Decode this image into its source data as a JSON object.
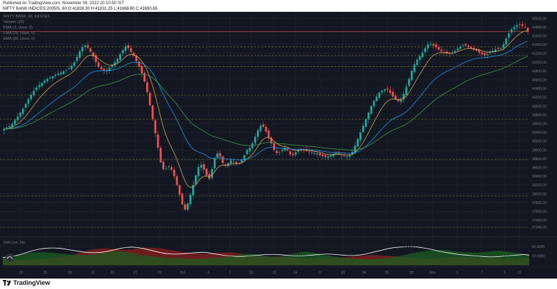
{
  "header": {
    "published": "Published on TradingView.com, November 09, 2022 20:10:50 IST",
    "symbol": "NIFTY BANK INDICES:2005IS, 60",
    "ohlc": "O:41828.30 H:41831.25 L:41668.80 C:41690.65"
  },
  "footer": {
    "brand": "TradingView"
  },
  "legend": {
    "title": "NIFTY BANK, 60, INDICES",
    "volume": "Volume (20)",
    "ema9": "EMA (9, close, 0)",
    "ema26": "EMA (26, close, 0)",
    "ema50": "EMA (50, close, 0)",
    "dmi": "DMI (14, 14)"
  },
  "colors": {
    "background": "#131722",
    "up": "#26a69a",
    "down": "#ef5350",
    "ema9": "#d4a955",
    "ema26": "#2196f3",
    "ema50": "#43a047",
    "hline": "#6b6a2f",
    "price_line": "#ef5350",
    "dmi_line": "#ffffff"
  },
  "chart_data": [
    {
      "type": "candlestick",
      "title": "NIFTY BANK, 60, INDICES",
      "last_price_label": "41690.65",
      "y_ticks": [
        "42000.00",
        "41800.00",
        "41600.00",
        "41400.00",
        "41200.00",
        "41000.00",
        "40800.00",
        "40600.00",
        "40400.00",
        "40200.00",
        "40000.00",
        "39800.00",
        "39600.00",
        "39400.00",
        "39200.00",
        "39000.00",
        "38800.00",
        "38600.00",
        "38400.00",
        "38200.00",
        "38000.00",
        "37800.00",
        "37600.00",
        "37400.00",
        "37240.00"
      ],
      "ylim": [
        37100,
        42100
      ],
      "x_ticks": [
        {
          "label": "13",
          "i": 0.11
        },
        {
          "label": "15",
          "i": 0.26
        },
        {
          "label": "19",
          "i": 0.41
        },
        {
          "label": "21",
          "i": 0.55
        },
        {
          "label": "23",
          "i": 0.67
        },
        {
          "label": "27",
          "i": 0.81
        },
        {
          "label": "29",
          "i": 0.96
        },
        {
          "label": "Oct",
          "i": 1.1
        },
        {
          "label": "6",
          "i": 1.26
        },
        {
          "label": "7",
          "i": 1.39
        },
        {
          "label": "10",
          "i": 1.52
        },
        {
          "label": "12",
          "i": 1.66
        },
        {
          "label": "14",
          "i": 1.79
        },
        {
          "label": "17",
          "i": 1.94
        },
        {
          "label": "20",
          "i": 2.08
        },
        {
          "label": "24",
          "i": 2.21
        },
        {
          "label": "26",
          "i": 2.35
        },
        {
          "label": "28",
          "i": 2.5
        },
        {
          "label": "Nov",
          "i": 2.63
        },
        {
          "label": "3",
          "i": 2.78
        },
        {
          "label": "7",
          "i": 2.93
        },
        {
          "label": "9",
          "i": 3.07
        },
        {
          "label": "12",
          "i": 3.16
        }
      ],
      "horizontal_levels": [
        41350,
        41150,
        40900,
        40250,
        39700,
        38780,
        37950,
        37240
      ],
      "series": [
        {
          "name": "EMA (9, close, 0)",
          "key": "ema9"
        },
        {
          "name": "EMA (26, close, 0)",
          "key": "ema26"
        },
        {
          "name": "EMA (50, close, 0)",
          "key": "ema50"
        }
      ],
      "closes": [
        39480,
        39510,
        39540,
        39600,
        39680,
        39760,
        39850,
        39940,
        40050,
        40160,
        40260,
        40350,
        40420,
        40480,
        40530,
        40580,
        40620,
        40650,
        40680,
        40710,
        40740,
        40760,
        40790,
        40820,
        40860,
        40920,
        41000,
        41120,
        41250,
        41340,
        41380,
        41330,
        41240,
        41130,
        41000,
        40900,
        40840,
        40800,
        40820,
        40870,
        40930,
        41000,
        41080,
        41180,
        41280,
        41360,
        41320,
        41230,
        41140,
        41020,
        40900,
        40750,
        40560,
        40320,
        40020,
        39700,
        39380,
        39050,
        38720,
        38560,
        38580,
        38620,
        38550,
        38400,
        38200,
        37980,
        37760,
        37640,
        37780,
        37980,
        38200,
        38420,
        38610,
        38660,
        38550,
        38420,
        38340,
        38560,
        38810,
        38920,
        38850,
        38700,
        38640,
        38700,
        38760,
        38730,
        38680,
        38700,
        38780,
        38880,
        39000,
        39050,
        39150,
        39300,
        39450,
        39550,
        39530,
        39420,
        39280,
        39150,
        39000,
        38930,
        38950,
        39000,
        39050,
        38990,
        38900,
        38880,
        38950,
        39000,
        39020,
        39000,
        38980,
        38960,
        38940,
        38930,
        38920,
        38880,
        38860,
        38840,
        38850,
        38880,
        38910,
        38930,
        38900,
        38880,
        38870,
        38860,
        38880,
        38960,
        39100,
        39250,
        39400,
        39550,
        39700,
        39850,
        40000,
        40120,
        40220,
        40300,
        40350,
        40380,
        40370,
        40300,
        40220,
        40150,
        40110,
        40160,
        40280,
        40440,
        40620,
        40800,
        40950,
        41060,
        41140,
        41220,
        41320,
        41400,
        41410,
        41380,
        41340,
        41290,
        41250,
        41220,
        41200,
        41190,
        41210,
        41260,
        41310,
        41360,
        41390,
        41380,
        41340,
        41310,
        41280,
        41260,
        41220,
        41180,
        41160,
        41190,
        41230,
        41260,
        41290,
        41300,
        41320,
        41410,
        41540,
        41660,
        41750,
        41800,
        41840,
        41850,
        41830,
        41790,
        41700
      ]
    },
    {
      "type": "area",
      "title": "DMI (14, 14)",
      "y_ticks": [
        "40.0000",
        "20.0000"
      ],
      "ylim": [
        0,
        55
      ],
      "series_colors": {
        "plus": "#1b5e20",
        "minus": "#7f1f1f",
        "adx": "#ffffff"
      },
      "plus_di": [
        18,
        20,
        22,
        24,
        26,
        27,
        28,
        28,
        27,
        26,
        25,
        24,
        23,
        22,
        22,
        23,
        24,
        26,
        28,
        30,
        30,
        28,
        26,
        24,
        22,
        20,
        18,
        17,
        16,
        16,
        15,
        15,
        14,
        14,
        14,
        15,
        16,
        17,
        18,
        19,
        22,
        24,
        25,
        24,
        22,
        20,
        18,
        17,
        20,
        23,
        26,
        28,
        29,
        27,
        25,
        22,
        20,
        18,
        16,
        15,
        14,
        14,
        13,
        13,
        14,
        15,
        16,
        18,
        20,
        23,
        26,
        28,
        30,
        32,
        33,
        33,
        32,
        30,
        29,
        28,
        27,
        27,
        28,
        29,
        30,
        31,
        30,
        28,
        26,
        25,
        24
      ],
      "minus_di": [
        14,
        13,
        12,
        11,
        11,
        12,
        13,
        14,
        15,
        16,
        18,
        20,
        22,
        26,
        30,
        33,
        35,
        36,
        36,
        35,
        34,
        33,
        34,
        36,
        38,
        38,
        37,
        36,
        34,
        32,
        30,
        28,
        27,
        26,
        25,
        25,
        26,
        27,
        27,
        28,
        26,
        24,
        22,
        20,
        19,
        18,
        18,
        19,
        18,
        17,
        16,
        15,
        14,
        14,
        14,
        15,
        16,
        16,
        17,
        18,
        19,
        20,
        21,
        22,
        22,
        21,
        20,
        19,
        18,
        17,
        16,
        15,
        14,
        14,
        14,
        15,
        16,
        17,
        18,
        18,
        17,
        16,
        15,
        15,
        14,
        14,
        13,
        13,
        14,
        15,
        16
      ],
      "adx": [
        17,
        18,
        20,
        23,
        27,
        31,
        34,
        36,
        37,
        37,
        36,
        34,
        32,
        30,
        28,
        27,
        27,
        28,
        30,
        33,
        36,
        38,
        39,
        38,
        36,
        33,
        30,
        27,
        25,
        24,
        24,
        25,
        26,
        27,
        28,
        27,
        25,
        23,
        21,
        20,
        19,
        19,
        20,
        21,
        22,
        23,
        23,
        23,
        22,
        21,
        20,
        20,
        21,
        22,
        23,
        24,
        24,
        23,
        22,
        21,
        21,
        22,
        24,
        27,
        30,
        33,
        36,
        38,
        39,
        40,
        40,
        39,
        37,
        35,
        32,
        29,
        27,
        25,
        23,
        22,
        21,
        20,
        19,
        18,
        18,
        19,
        20,
        21,
        22,
        23,
        22
      ]
    }
  ]
}
